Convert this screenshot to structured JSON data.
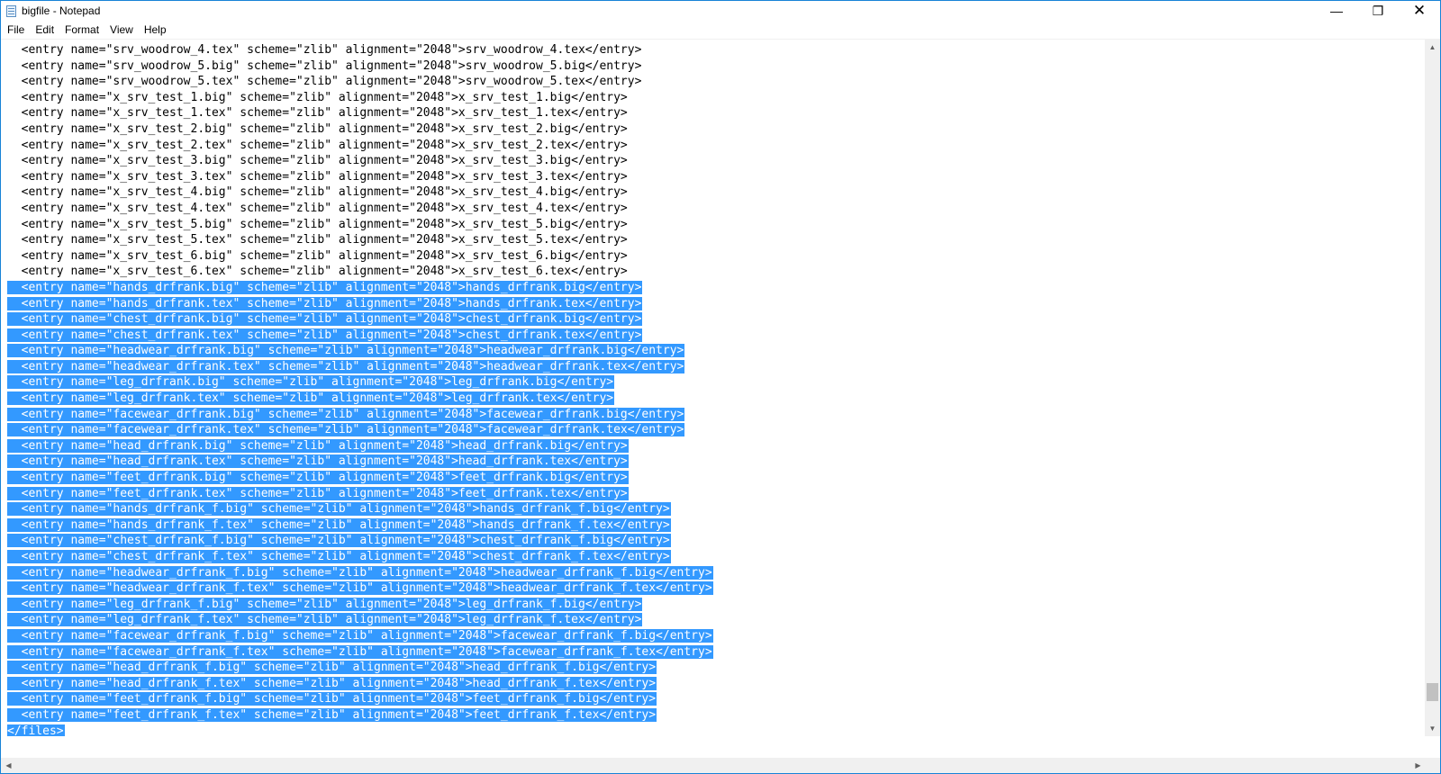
{
  "window": {
    "title": "bigfile - Notepad",
    "accent_color": "#1883d7",
    "selection_color": "#3399ff",
    "icons": {
      "app": "notepad-icon",
      "minimize": "minimize-icon",
      "maximize": "restore-icon",
      "close": "close-icon"
    },
    "minimize_glyph": "—",
    "restore_glyph": "❐",
    "close_glyph": "✕"
  },
  "menu": [
    "File",
    "Edit",
    "Format",
    "View",
    "Help"
  ],
  "scrollbar": {
    "up_glyph": "▲",
    "down_glyph": "▼",
    "left_glyph": "◀",
    "right_glyph": "▶",
    "vertical_position": 0.97
  },
  "lines": [
    {
      "text": "  <entry name=\"srv_woodrow_4.tex\" scheme=\"zlib\" alignment=\"2048\">srv_woodrow_4.tex</entry>",
      "selected": false
    },
    {
      "text": "  <entry name=\"srv_woodrow_5.big\" scheme=\"zlib\" alignment=\"2048\">srv_woodrow_5.big</entry>",
      "selected": false
    },
    {
      "text": "  <entry name=\"srv_woodrow_5.tex\" scheme=\"zlib\" alignment=\"2048\">srv_woodrow_5.tex</entry>",
      "selected": false
    },
    {
      "text": "  <entry name=\"x_srv_test_1.big\" scheme=\"zlib\" alignment=\"2048\">x_srv_test_1.big</entry>",
      "selected": false
    },
    {
      "text": "  <entry name=\"x_srv_test_1.tex\" scheme=\"zlib\" alignment=\"2048\">x_srv_test_1.tex</entry>",
      "selected": false
    },
    {
      "text": "  <entry name=\"x_srv_test_2.big\" scheme=\"zlib\" alignment=\"2048\">x_srv_test_2.big</entry>",
      "selected": false
    },
    {
      "text": "  <entry name=\"x_srv_test_2.tex\" scheme=\"zlib\" alignment=\"2048\">x_srv_test_2.tex</entry>",
      "selected": false
    },
    {
      "text": "  <entry name=\"x_srv_test_3.big\" scheme=\"zlib\" alignment=\"2048\">x_srv_test_3.big</entry>",
      "selected": false
    },
    {
      "text": "  <entry name=\"x_srv_test_3.tex\" scheme=\"zlib\" alignment=\"2048\">x_srv_test_3.tex</entry>",
      "selected": false
    },
    {
      "text": "  <entry name=\"x_srv_test_4.big\" scheme=\"zlib\" alignment=\"2048\">x_srv_test_4.big</entry>",
      "selected": false
    },
    {
      "text": "  <entry name=\"x_srv_test_4.tex\" scheme=\"zlib\" alignment=\"2048\">x_srv_test_4.tex</entry>",
      "selected": false
    },
    {
      "text": "  <entry name=\"x_srv_test_5.big\" scheme=\"zlib\" alignment=\"2048\">x_srv_test_5.big</entry>",
      "selected": false
    },
    {
      "text": "  <entry name=\"x_srv_test_5.tex\" scheme=\"zlib\" alignment=\"2048\">x_srv_test_5.tex</entry>",
      "selected": false
    },
    {
      "text": "  <entry name=\"x_srv_test_6.big\" scheme=\"zlib\" alignment=\"2048\">x_srv_test_6.big</entry>",
      "selected": false
    },
    {
      "text": "  <entry name=\"x_srv_test_6.tex\" scheme=\"zlib\" alignment=\"2048\">x_srv_test_6.tex</entry>",
      "selected": false
    },
    {
      "text": "  <entry name=\"hands_drfrank.big\" scheme=\"zlib\" alignment=\"2048\">hands_drfrank.big</entry>",
      "selected": true
    },
    {
      "text": "  <entry name=\"hands_drfrank.tex\" scheme=\"zlib\" alignment=\"2048\">hands_drfrank.tex</entry>",
      "selected": true
    },
    {
      "text": "  <entry name=\"chest_drfrank.big\" scheme=\"zlib\" alignment=\"2048\">chest_drfrank.big</entry>",
      "selected": true
    },
    {
      "text": "  <entry name=\"chest_drfrank.tex\" scheme=\"zlib\" alignment=\"2048\">chest_drfrank.tex</entry>",
      "selected": true
    },
    {
      "text": "  <entry name=\"headwear_drfrank.big\" scheme=\"zlib\" alignment=\"2048\">headwear_drfrank.big</entry>",
      "selected": true
    },
    {
      "text": "  <entry name=\"headwear_drfrank.tex\" scheme=\"zlib\" alignment=\"2048\">headwear_drfrank.tex</entry>",
      "selected": true
    },
    {
      "text": "  <entry name=\"leg_drfrank.big\" scheme=\"zlib\" alignment=\"2048\">leg_drfrank.big</entry>",
      "selected": true
    },
    {
      "text": "  <entry name=\"leg_drfrank.tex\" scheme=\"zlib\" alignment=\"2048\">leg_drfrank.tex</entry>",
      "selected": true
    },
    {
      "text": "  <entry name=\"facewear_drfrank.big\" scheme=\"zlib\" alignment=\"2048\">facewear_drfrank.big</entry>",
      "selected": true
    },
    {
      "text": "  <entry name=\"facewear_drfrank.tex\" scheme=\"zlib\" alignment=\"2048\">facewear_drfrank.tex</entry>",
      "selected": true
    },
    {
      "text": "  <entry name=\"head_drfrank.big\" scheme=\"zlib\" alignment=\"2048\">head_drfrank.big</entry>",
      "selected": true
    },
    {
      "text": "  <entry name=\"head_drfrank.tex\" scheme=\"zlib\" alignment=\"2048\">head_drfrank.tex</entry>",
      "selected": true
    },
    {
      "text": "  <entry name=\"feet_drfrank.big\" scheme=\"zlib\" alignment=\"2048\">feet_drfrank.big</entry>",
      "selected": true
    },
    {
      "text": "  <entry name=\"feet_drfrank.tex\" scheme=\"zlib\" alignment=\"2048\">feet_drfrank.tex</entry>",
      "selected": true
    },
    {
      "text": "  <entry name=\"hands_drfrank_f.big\" scheme=\"zlib\" alignment=\"2048\">hands_drfrank_f.big</entry>",
      "selected": true
    },
    {
      "text": "  <entry name=\"hands_drfrank_f.tex\" scheme=\"zlib\" alignment=\"2048\">hands_drfrank_f.tex</entry>",
      "selected": true
    },
    {
      "text": "  <entry name=\"chest_drfrank_f.big\" scheme=\"zlib\" alignment=\"2048\">chest_drfrank_f.big</entry>",
      "selected": true
    },
    {
      "text": "  <entry name=\"chest_drfrank_f.tex\" scheme=\"zlib\" alignment=\"2048\">chest_drfrank_f.tex</entry>",
      "selected": true
    },
    {
      "text": "  <entry name=\"headwear_drfrank_f.big\" scheme=\"zlib\" alignment=\"2048\">headwear_drfrank_f.big</entry>",
      "selected": true
    },
    {
      "text": "  <entry name=\"headwear_drfrank_f.tex\" scheme=\"zlib\" alignment=\"2048\">headwear_drfrank_f.tex</entry>",
      "selected": true
    },
    {
      "text": "  <entry name=\"leg_drfrank_f.big\" scheme=\"zlib\" alignment=\"2048\">leg_drfrank_f.big</entry>",
      "selected": true
    },
    {
      "text": "  <entry name=\"leg_drfrank_f.tex\" scheme=\"zlib\" alignment=\"2048\">leg_drfrank_f.tex</entry>",
      "selected": true
    },
    {
      "text": "  <entry name=\"facewear_drfrank_f.big\" scheme=\"zlib\" alignment=\"2048\">facewear_drfrank_f.big</entry>",
      "selected": true
    },
    {
      "text": "  <entry name=\"facewear_drfrank_f.tex\" scheme=\"zlib\" alignment=\"2048\">facewear_drfrank_f.tex</entry>",
      "selected": true
    },
    {
      "text": "  <entry name=\"head_drfrank_f.big\" scheme=\"zlib\" alignment=\"2048\">head_drfrank_f.big</entry>",
      "selected": true
    },
    {
      "text": "  <entry name=\"head_drfrank_f.tex\" scheme=\"zlib\" alignment=\"2048\">head_drfrank_f.tex</entry>",
      "selected": true
    },
    {
      "text": "  <entry name=\"feet_drfrank_f.big\" scheme=\"zlib\" alignment=\"2048\">feet_drfrank_f.big</entry>",
      "selected": true
    },
    {
      "text": "  <entry name=\"feet_drfrank_f.tex\" scheme=\"zlib\" alignment=\"2048\">feet_drfrank_f.tex</entry>",
      "selected": true
    },
    {
      "text": "</files>",
      "selected": true
    }
  ]
}
